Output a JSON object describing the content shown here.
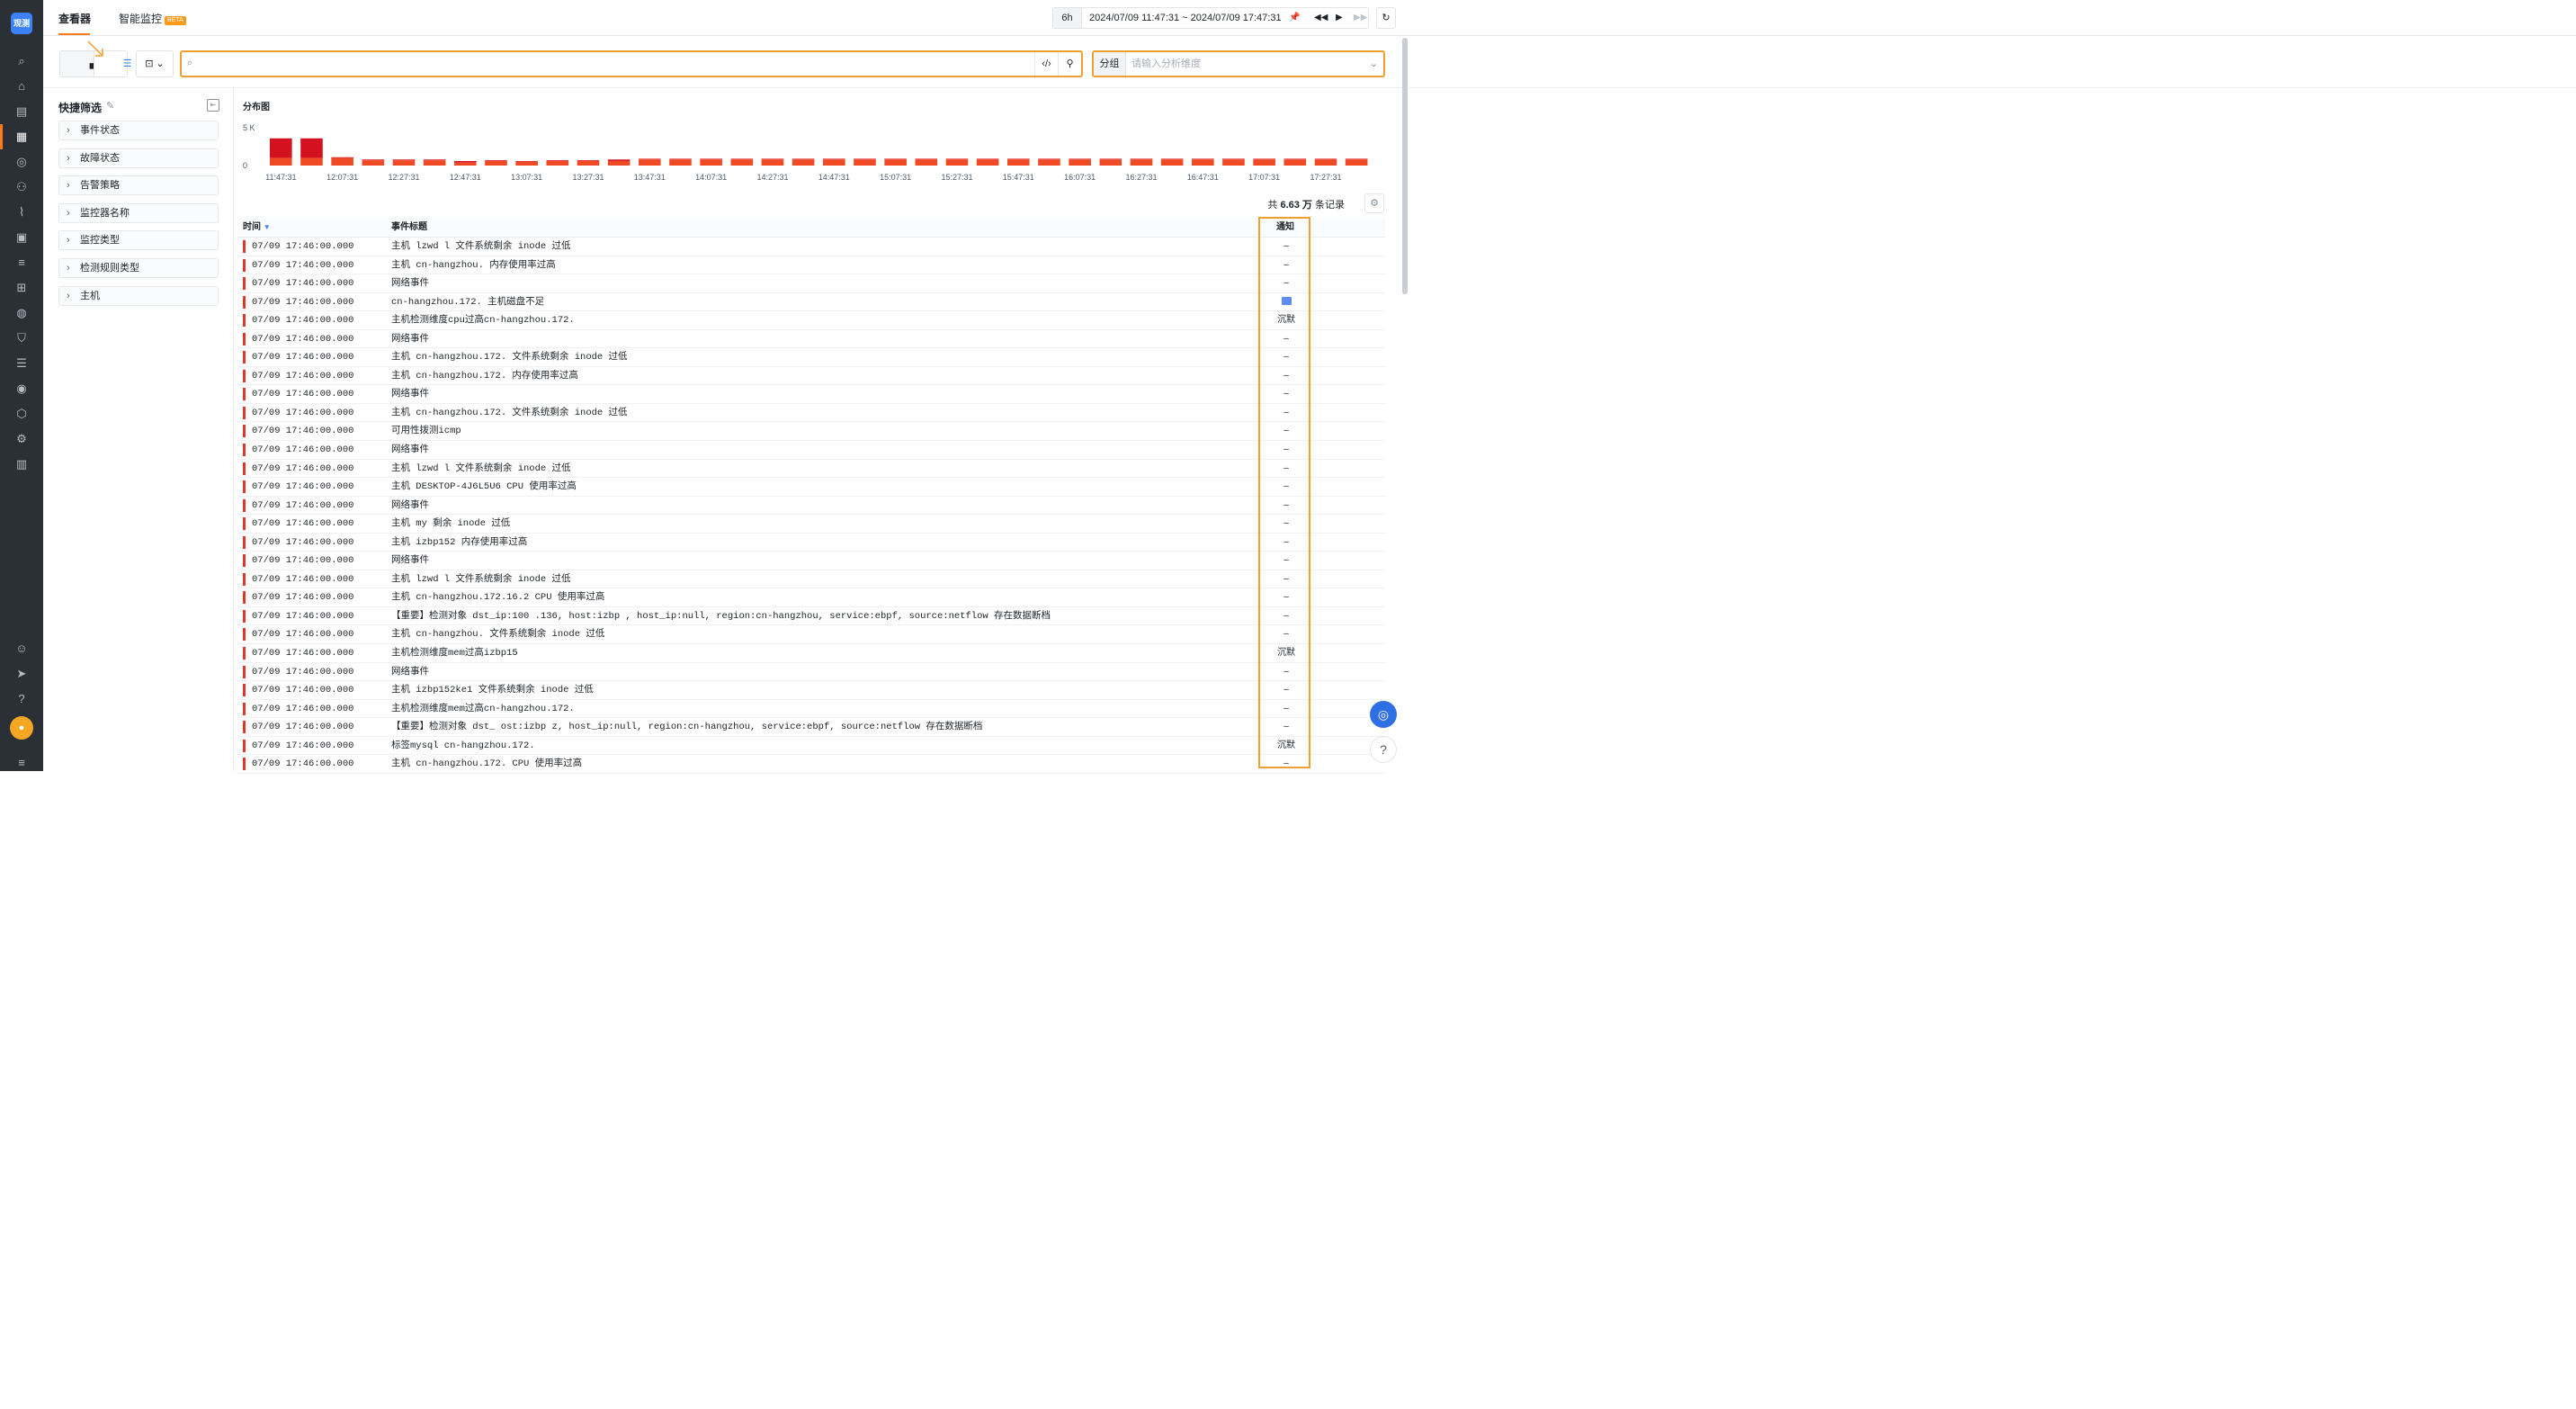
{
  "app": {
    "logo_text": "观测"
  },
  "tabs": [
    {
      "label": "查看器"
    },
    {
      "label": "智能监控",
      "badge": "BETA"
    }
  ],
  "time": {
    "preset": "6h",
    "range": "2024/07/09 11:47:31 ~ 2024/07/09 17:47:31"
  },
  "toolbar": {
    "search_placeholder": "",
    "group_label": "分组",
    "group_placeholder": "请输入分析维度"
  },
  "quick_filter": {
    "title": "快捷筛选",
    "items": [
      "事件状态",
      "故障状态",
      "告警策略",
      "监控器名称",
      "监控类型",
      "检测规则类型",
      "主机"
    ]
  },
  "chart_data": {
    "type": "bar",
    "title": "分布图",
    "y_ticks": [
      "5 K",
      "0"
    ],
    "ylim": [
      0,
      5000
    ],
    "x_ticks": [
      "11:47:31",
      "12:07:31",
      "12:27:31",
      "12:47:31",
      "13:07:31",
      "13:27:31",
      "13:47:31",
      "14:07:31",
      "14:27:31",
      "14:47:31",
      "15:07:31",
      "15:27:31",
      "15:47:31",
      "16:07:31",
      "16:27:31",
      "16:47:31",
      "17:07:31",
      "17:27:31"
    ],
    "colors": {
      "top": "#d4121f",
      "bottom": "#f04a24"
    },
    "series": [
      {
        "values": [
          3600,
          3600,
          1100,
          800,
          800,
          800,
          600,
          700,
          600,
          700,
          700,
          800,
          900,
          900,
          900,
          900,
          900,
          900,
          900,
          900,
          900,
          900,
          900,
          900,
          900,
          900,
          900,
          900,
          900,
          900,
          900,
          900,
          900,
          900,
          900,
          900
        ]
      },
      {
        "values": [
          1000,
          1000,
          1000,
          700,
          700,
          700,
          400,
          600,
          500,
          600,
          600,
          600,
          800,
          800,
          800,
          800,
          800,
          800,
          800,
          800,
          800,
          800,
          800,
          800,
          800,
          800,
          800,
          800,
          800,
          800,
          800,
          800,
          800,
          800,
          800,
          800
        ]
      }
    ]
  },
  "table": {
    "total_prefix": "共",
    "total_value": "6.63 万",
    "total_suffix": "条记录",
    "headers": {
      "time": "时间",
      "title": "事件标题",
      "notice": "通知"
    },
    "rows": [
      {
        "time": "07/09 17:46:00.000",
        "title": "主机 lzwd                  l 文件系统剩余 inode 过低",
        "notice": "–"
      },
      {
        "time": "07/09 17:46:00.000",
        "title": "主机 cn-hangzhou.               内存使用率过高",
        "notice": "–"
      },
      {
        "time": "07/09 17:46:00.000",
        "title": "网络事件",
        "notice": "–"
      },
      {
        "time": "07/09 17:46:00.000",
        "title": "cn-hangzhou.172.            主机磁盘不足",
        "notice": "mail"
      },
      {
        "time": "07/09 17:46:00.000",
        "title": "主机检测维度cpu过高cn-hangzhou.172.",
        "notice": "沉默"
      },
      {
        "time": "07/09 17:46:00.000",
        "title": "网络事件",
        "notice": "–"
      },
      {
        "time": "07/09 17:46:00.000",
        "title": "主机 cn-hangzhou.172.           文件系统剩余 inode 过低",
        "notice": "–"
      },
      {
        "time": "07/09 17:46:00.000",
        "title": "主机 cn-hangzhou.172.           内存使用率过高",
        "notice": "–"
      },
      {
        "time": "07/09 17:46:00.000",
        "title": "网络事件",
        "notice": "–"
      },
      {
        "time": "07/09 17:46:00.000",
        "title": "主机 cn-hangzhou.172.           文件系统剩余 inode 过低",
        "notice": "–"
      },
      {
        "time": "07/09 17:46:00.000",
        "title": "可用性拨测icmp",
        "notice": "–"
      },
      {
        "time": "07/09 17:46:00.000",
        "title": "网络事件",
        "notice": "–"
      },
      {
        "time": "07/09 17:46:00.000",
        "title": "主机 lzwd                  l 文件系统剩余 inode 过低",
        "notice": "–"
      },
      {
        "time": "07/09 17:46:00.000",
        "title": "主机 DESKTOP-4J6L5U6 CPU 使用率过高",
        "notice": "–"
      },
      {
        "time": "07/09 17:46:00.000",
        "title": "网络事件",
        "notice": "–"
      },
      {
        "time": "07/09 17:46:00.000",
        "title": "主机 my                 剩余 inode 过低",
        "notice": "–"
      },
      {
        "time": "07/09 17:46:00.000",
        "title": "主机 izbp152                 内存使用率过高",
        "notice": "–"
      },
      {
        "time": "07/09 17:46:00.000",
        "title": "网络事件",
        "notice": "–"
      },
      {
        "time": "07/09 17:46:00.000",
        "title": "主机 lzwd                  l 文件系统剩余 inode 过低",
        "notice": "–"
      },
      {
        "time": "07/09 17:46:00.000",
        "title": "主机 cn-hangzhou.172.16.2      CPU 使用率过高",
        "notice": "–"
      },
      {
        "time": "07/09 17:46:00.000",
        "title": "【重要】检测对象 dst_ip:100      .136, host:izbp                      , host_ip:null, region:cn-hangzhou, service:ebpf, source:netflow 存在数据断档",
        "notice": "–"
      },
      {
        "time": "07/09 17:46:00.000",
        "title": "主机 cn-hangzhou.               文件系统剩余 inode 过低",
        "notice": "–"
      },
      {
        "time": "07/09 17:46:00.000",
        "title": "主机检测维度mem过高izbp15",
        "notice": "沉默"
      },
      {
        "time": "07/09 17:46:00.000",
        "title": "网络事件",
        "notice": "–"
      },
      {
        "time": "07/09 17:46:00.000",
        "title": "主机 izbp152ke1              文件系统剩余 inode 过低",
        "notice": "–"
      },
      {
        "time": "07/09 17:46:00.000",
        "title": "主机检测维度mem过高cn-hangzhou.172.",
        "notice": "–"
      },
      {
        "time": "07/09 17:46:00.000",
        "title": "【重要】检测对象 dst_                 ost:izbp                      z, host_ip:null, region:cn-hangzhou, service:ebpf, source:netflow 存在数据断档",
        "notice": "–"
      },
      {
        "time": "07/09 17:46:00.000",
        "title": "标签mysql cn-hangzhou.172.",
        "notice": "沉默"
      },
      {
        "time": "07/09 17:46:00.000",
        "title": "主机 cn-hangzhou.172.           CPU 使用率过高",
        "notice": "–"
      }
    ]
  }
}
